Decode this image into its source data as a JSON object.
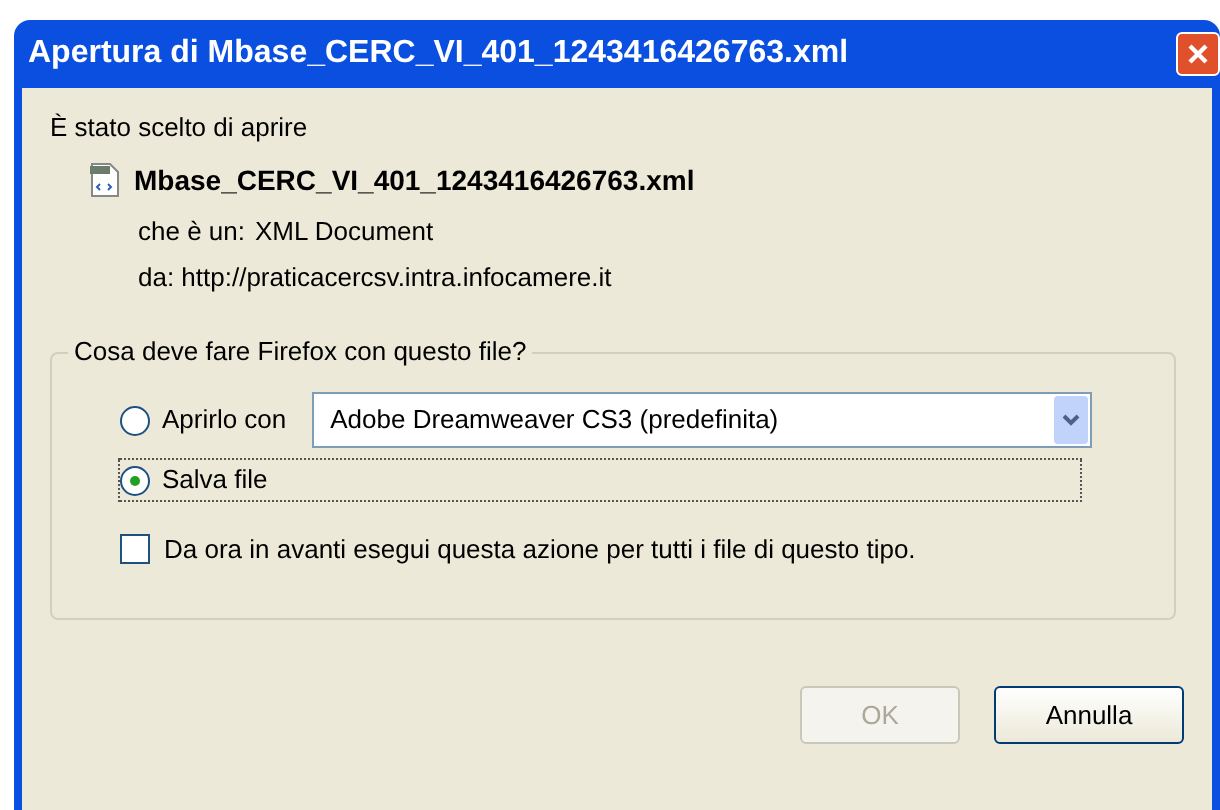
{
  "window": {
    "title": "Apertura di Mbase_CERC_VI_401_1243416426763.xml"
  },
  "intro": "È stato scelto di aprire",
  "file": {
    "name": "Mbase_CERC_VI_401_1243416426763.xml",
    "type_label": "che è un:",
    "type": "XML Document",
    "from": "da: http://praticacercsv.intra.infocamere.it"
  },
  "group": {
    "legend": "Cosa deve fare Firefox con questo file?",
    "options": [
      {
        "kind": "open",
        "label": "Aprirlo con",
        "selected": false,
        "app": "Adobe Dreamweaver CS3 (predefinita)"
      },
      {
        "kind": "save",
        "label": "Salva file",
        "selected": true
      }
    ],
    "remember": {
      "label": "Da ora in avanti esegui questa azione per tutti i file di questo tipo.",
      "checked": false
    }
  },
  "buttons": [
    {
      "label": "OK",
      "disabled": true
    },
    {
      "label": "Annulla",
      "disabled": false
    }
  ]
}
